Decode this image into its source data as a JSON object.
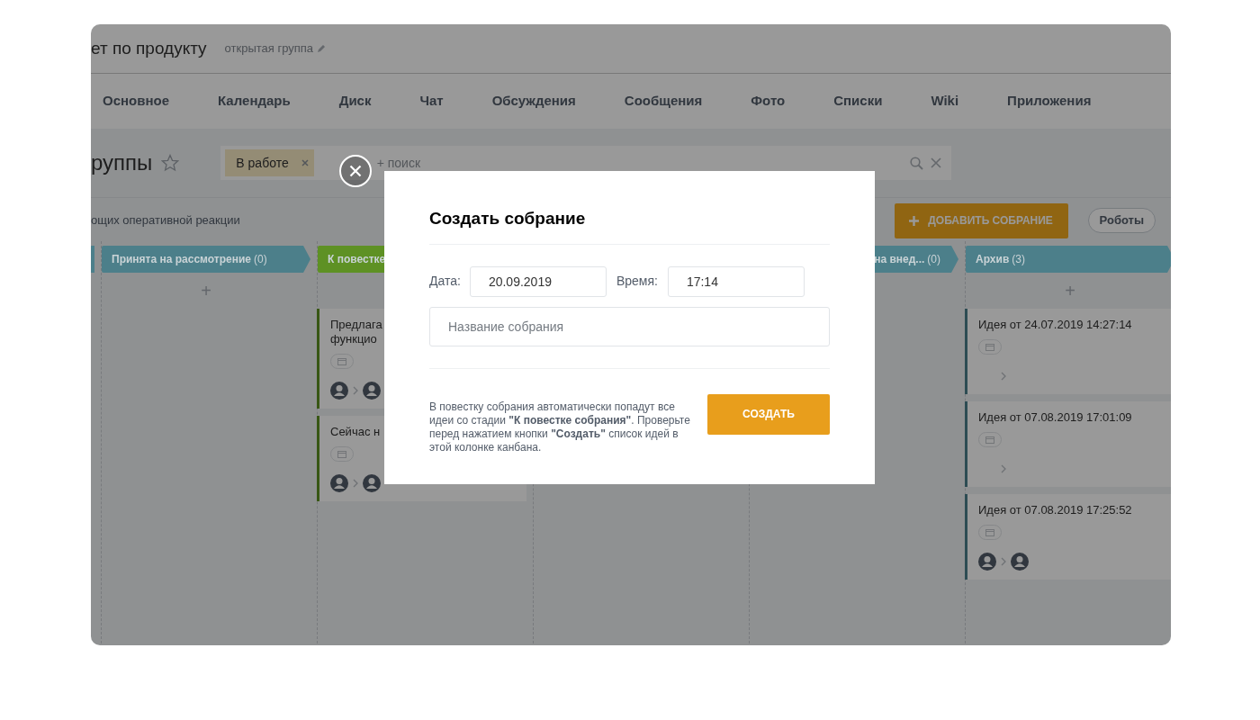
{
  "header": {
    "title": "ет по продукту",
    "group_type": "открытая группа"
  },
  "nav": {
    "items": [
      {
        "label": "Основное"
      },
      {
        "label": "Календарь"
      },
      {
        "label": "Диск"
      },
      {
        "label": "Чат"
      },
      {
        "label": "Обсуждения"
      },
      {
        "label": "Сообщения"
      },
      {
        "label": "Фото"
      },
      {
        "label": "Списки"
      },
      {
        "label": "Wiki"
      },
      {
        "label": "Приложения"
      }
    ]
  },
  "toolbar": {
    "title": "руппы",
    "filter": {
      "tags": [
        {
          "label": "В работе"
        }
      ],
      "placeholder": "+ поиск"
    }
  },
  "actions": {
    "subtitle": "ощих оперативной реакции",
    "add_button": "ДОБАВИТЬ СОБРАНИЕ",
    "robots_button": "Роботы"
  },
  "columns": [
    {
      "kind": "stub",
      "color": "#4c7f8a"
    },
    {
      "kind": "stage",
      "title": "Принята на рассмотрение",
      "count": "(0)",
      "color": "#4c7f8a",
      "add_label": "+"
    },
    {
      "kind": "stage",
      "title": "К повестке",
      "color": "#5e9124",
      "cards": [
        {
          "lines": [
            "Предлага",
            "функцио"
          ],
          "avatars": true
        },
        {
          "lines": [
            "Сейчас н"
          ],
          "avatars": true
        }
      ]
    },
    {
      "kind": "hidden"
    },
    {
      "kind": "stage-tail",
      "title": "на внед...",
      "count": "(0)",
      "color": "#4c7f8a"
    },
    {
      "kind": "stage",
      "title": "Архив",
      "count": "(3)",
      "color": "#4c7f8a",
      "add_label": "+",
      "cards": [
        {
          "lines": [
            "Идея от 24.07.2019 14:27:14"
          ],
          "avatars": false
        },
        {
          "lines": [
            "Идея от 07.08.2019 17:01:09"
          ],
          "avatars": false
        },
        {
          "lines": [
            "Идея от 07.08.2019 17:25:52"
          ],
          "avatars": true
        }
      ]
    }
  ],
  "modal": {
    "title": "Создать собрание",
    "date_label": "Дата:",
    "date": "20.09.2019",
    "time_label": "Время:",
    "time": "17:14",
    "name_placeholder": "Название собрания",
    "note": "В повестку собрания автоматически попадут все идеи со стадии **\"К повестке собрания\"**. Проверьте перед нажатием кнопки **\"Создать\"** список идей в этой колонке канбана.",
    "create_button": "СОЗДАТЬ"
  }
}
